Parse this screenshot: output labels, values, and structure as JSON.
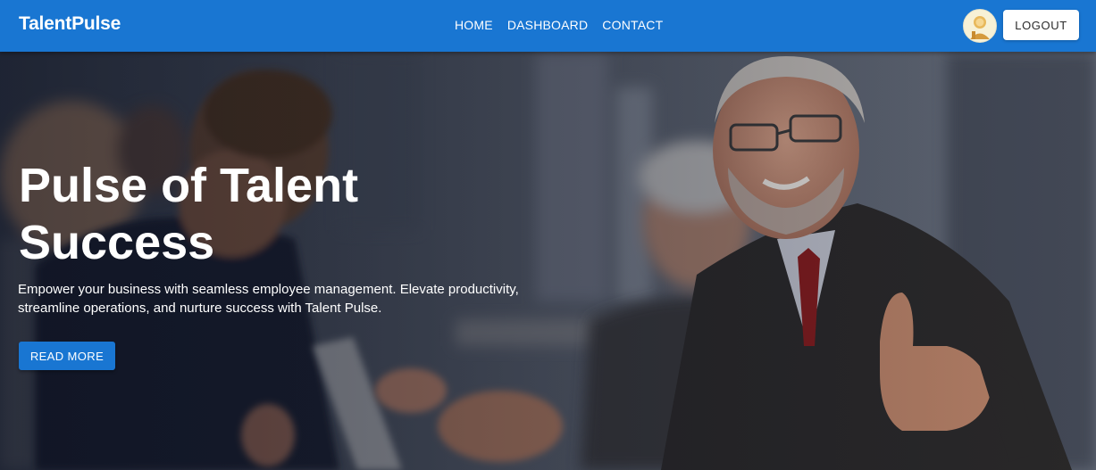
{
  "navbar": {
    "brand": "TalentPulse",
    "links": [
      {
        "label": "HOME"
      },
      {
        "label": "DASHBOARD"
      },
      {
        "label": "CONTACT"
      }
    ],
    "logout_label": "LOGOUT",
    "color": "#1976d2"
  },
  "hero": {
    "title": "Pulse of Talent Success",
    "text": "Empower your business with seamless employee management. Elevate productivity, streamline operations, and nurture success with Talent Pulse.",
    "button_label": "READ MORE"
  }
}
